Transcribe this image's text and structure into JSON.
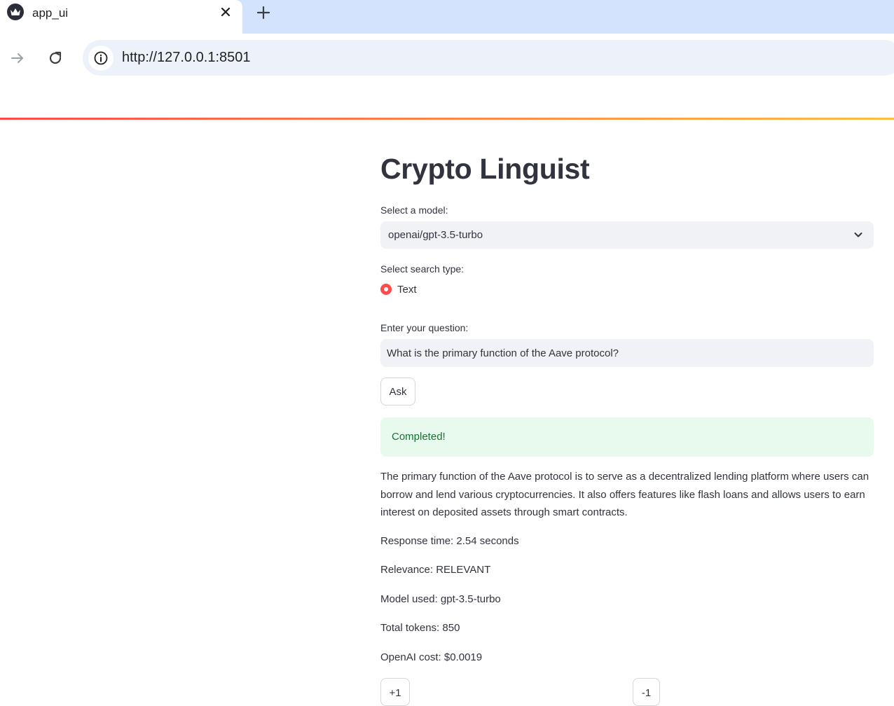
{
  "browser": {
    "tab_title": "app_ui",
    "tab_close_icon": "close-icon",
    "new_tab_icon": "plus-icon",
    "url": "http://127.0.0.1:8501"
  },
  "app": {
    "title": "Crypto Linguist",
    "model_select": {
      "label": "Select a model:",
      "value": "openai/gpt-3.5-turbo"
    },
    "search_type": {
      "label": "Select search type:",
      "options": [
        "Text"
      ],
      "selected": "Text"
    },
    "question": {
      "label": "Enter your question:",
      "value": "What is the primary function of the Aave protocol?"
    },
    "ask_button": "Ask",
    "status": "Completed!",
    "answer": "The primary function of the Aave protocol is to serve as a decentralized lending platform where users can borrow and lend various cryptocurrencies. It also offers features like flash loans and allows users to earn interest on deposited assets through smart contracts.",
    "stats": {
      "response_time": "Response time: 2.54 seconds",
      "relevance": "Relevance: RELEVANT",
      "model_used": "Model used: gpt-3.5-turbo",
      "total_tokens": "Total tokens: 850",
      "cost": "OpenAI cost: $0.0019"
    },
    "feedback": {
      "plus_label": "+1",
      "minus_label": "-1"
    }
  },
  "colors": {
    "accent": "#ff4b4b",
    "success_bg": "#e8f9ee",
    "success_text": "#177233",
    "tabstrip": "#d3e3fd"
  }
}
